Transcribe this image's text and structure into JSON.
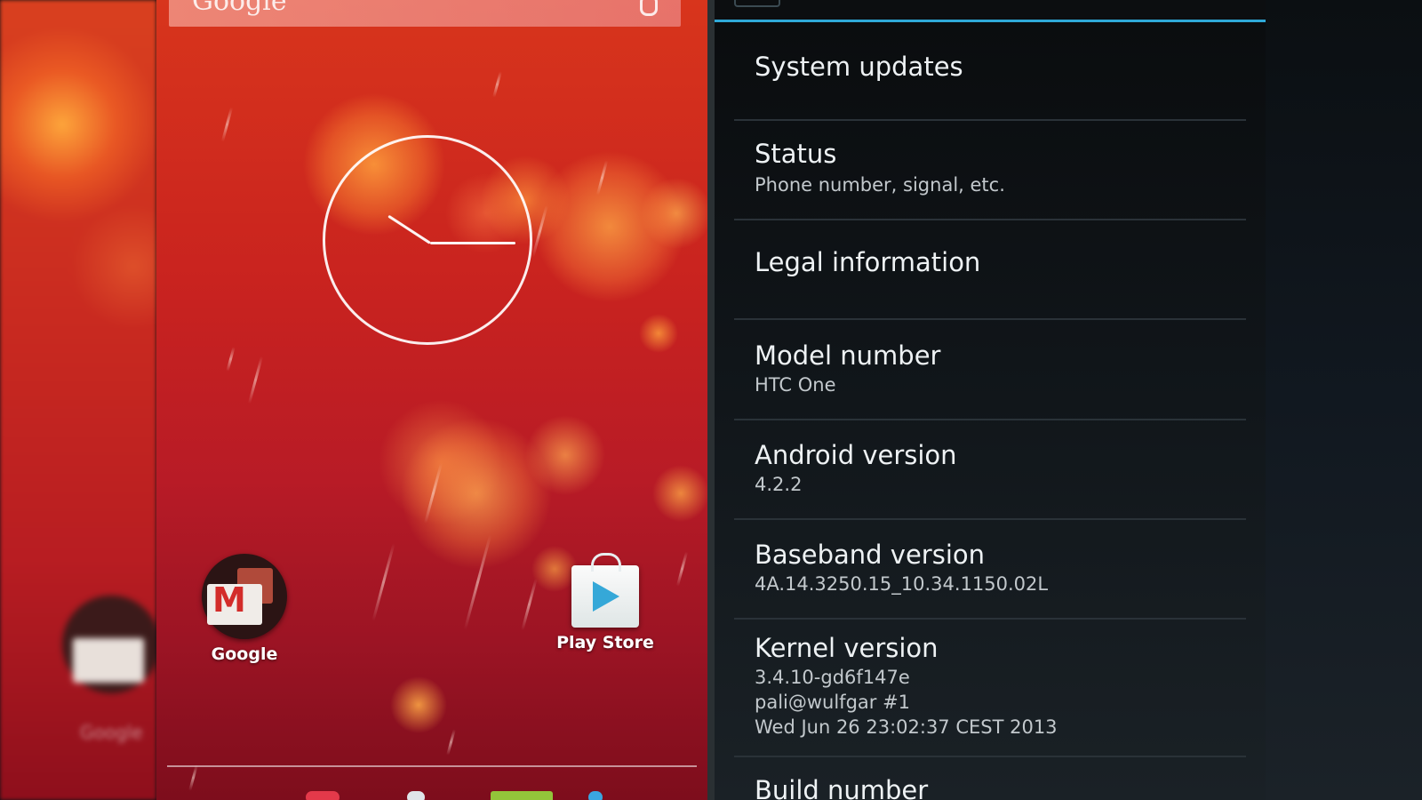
{
  "home": {
    "search_label": "Google",
    "apps": [
      {
        "label": "Google"
      },
      {
        "label": "Play Store"
      }
    ],
    "ghost_label": "Google"
  },
  "settings": {
    "items": [
      {
        "title": "System updates",
        "subtitle": ""
      },
      {
        "title": "Status",
        "subtitle": "Phone number, signal, etc."
      },
      {
        "title": "Legal information",
        "subtitle": ""
      },
      {
        "title": "Model number",
        "subtitle": "HTC One"
      },
      {
        "title": "Android version",
        "subtitle": "4.2.2"
      },
      {
        "title": "Baseband version",
        "subtitle": "4A.14.3250.15_10.34.1150.02L"
      },
      {
        "title": "Kernel version",
        "subtitle_lines": [
          "3.4.10-gd6f147e",
          "pali@wulfgar #1",
          "Wed Jun 26 23:02:37 CEST 2013"
        ]
      },
      {
        "title": "Build number",
        "subtitle": ""
      }
    ]
  },
  "colors": {
    "accent": "#2fa9d8",
    "wallpaper_red": "#c9231f",
    "settings_bg": "#101519"
  }
}
